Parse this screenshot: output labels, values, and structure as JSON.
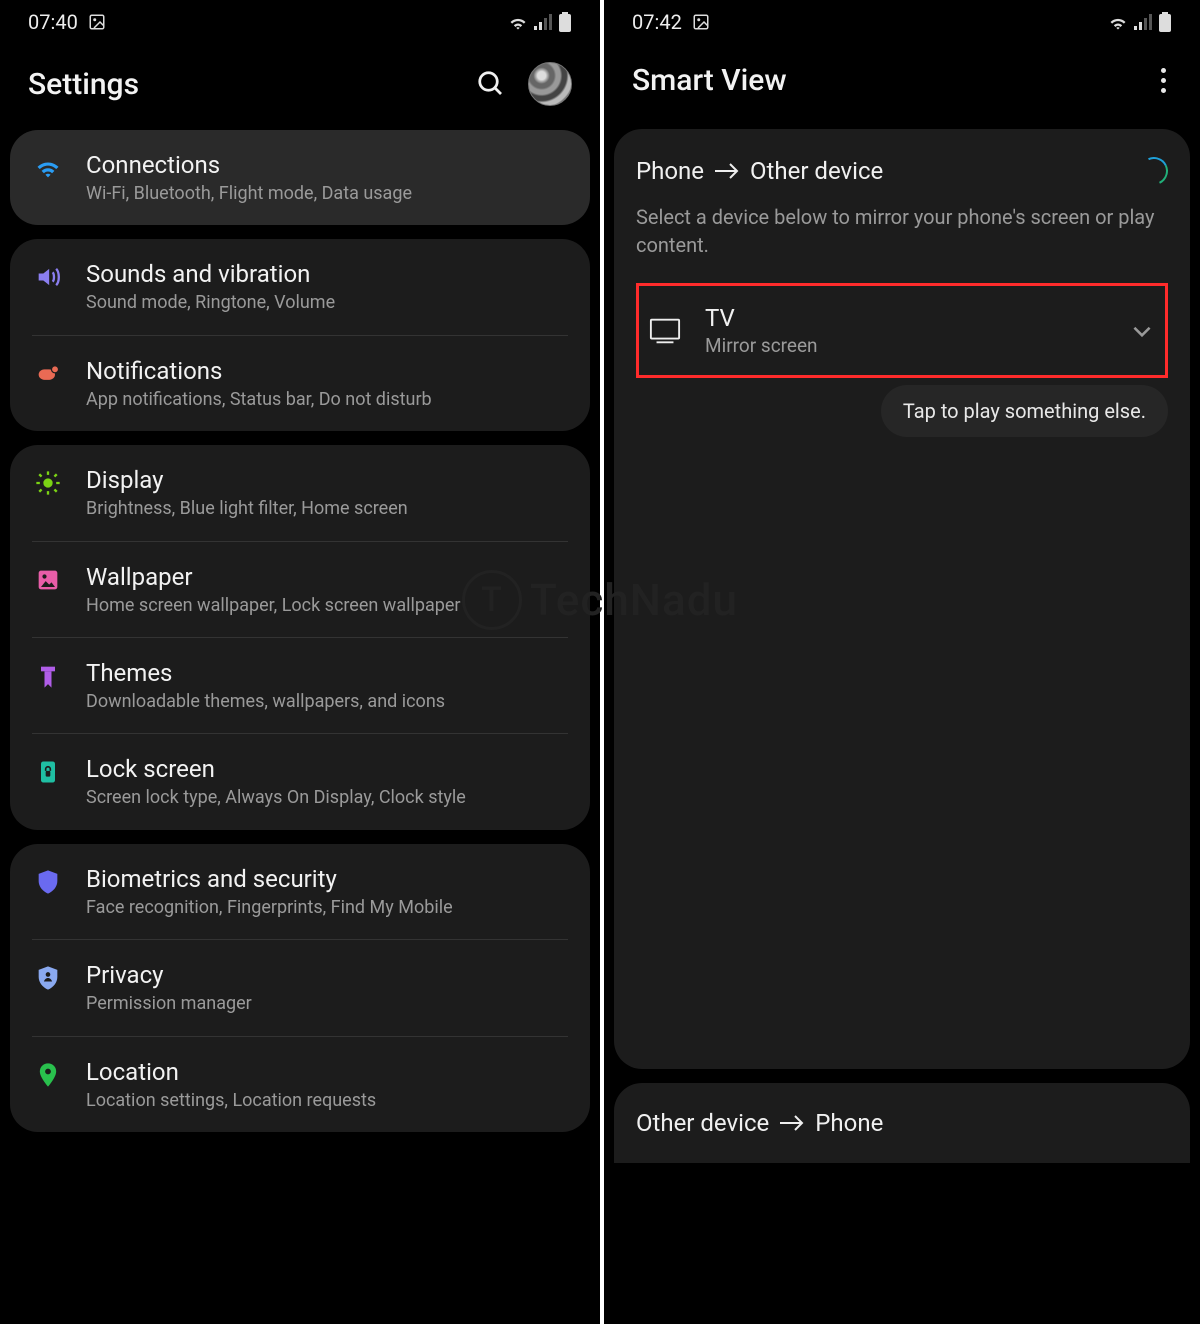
{
  "left": {
    "statusbar": {
      "time": "07:40"
    },
    "header": {
      "title": "Settings"
    },
    "groups": [
      {
        "light": true,
        "items": [
          {
            "icon": "wifi-icon",
            "color": "#2a9df4",
            "title": "Connections",
            "sub": "Wi-Fi, Bluetooth, Flight mode, Data usage"
          }
        ]
      },
      {
        "items": [
          {
            "icon": "sound-icon",
            "color": "#8b7ef0",
            "title": "Sounds and vibration",
            "sub": "Sound mode, Ringtone, Volume"
          },
          {
            "icon": "notifications-icon",
            "color": "#e96a54",
            "title": "Notifications",
            "sub": "App notifications, Status bar, Do not disturb"
          }
        ]
      },
      {
        "items": [
          {
            "icon": "display-icon",
            "color": "#7bd314",
            "title": "Display",
            "sub": "Brightness, Blue light filter, Home screen"
          },
          {
            "icon": "wallpaper-icon",
            "color": "#e85da8",
            "title": "Wallpaper",
            "sub": "Home screen wallpaper, Lock screen wallpaper"
          },
          {
            "icon": "themes-icon",
            "color": "#b05de8",
            "title": "Themes",
            "sub": "Downloadable themes, wallpapers, and icons"
          },
          {
            "icon": "lockscreen-icon",
            "color": "#1fbfa3",
            "title": "Lock screen",
            "sub": "Screen lock type, Always On Display, Clock style"
          }
        ]
      },
      {
        "items": [
          {
            "icon": "security-icon",
            "color": "#6a6af0",
            "title": "Biometrics and security",
            "sub": "Face recognition, Fingerprints, Find My Mobile"
          },
          {
            "icon": "privacy-icon",
            "color": "#8aa9f0",
            "title": "Privacy",
            "sub": "Permission manager"
          },
          {
            "icon": "location-icon",
            "color": "#29c04d",
            "title": "Location",
            "sub": "Location settings, Location requests"
          }
        ]
      }
    ]
  },
  "right": {
    "statusbar": {
      "time": "07:42"
    },
    "header": {
      "title": "Smart View"
    },
    "direction_from": "Phone",
    "direction_to": "Other device",
    "help": "Select a device below to mirror your phone's screen or play content.",
    "device": {
      "title": "TV",
      "sub": "Mirror screen"
    },
    "pill": "Tap to play something else.",
    "bottom_from": "Other device",
    "bottom_to": "Phone"
  },
  "watermark": "TechNadu"
}
